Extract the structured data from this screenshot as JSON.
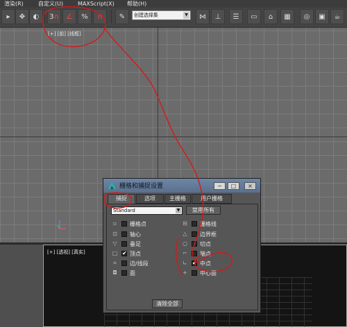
{
  "menu": [
    "渲染(R)",
    "自定义(U)",
    "MAXScript(X)",
    "帮助(H)"
  ],
  "toolbar": {
    "buttons": [
      "select-icon",
      "move-icon",
      "rotate-icon",
      "snap-3d-icon",
      "angle-snap-icon",
      "percent-snap-icon",
      "spinner-snap-icon",
      "named-selection-icon",
      "mirror-icon",
      "align-icon",
      "layer-icon",
      "graph-editor-icon",
      "schematic-icon",
      "material-editor-icon",
      "render-setup-icon",
      "render-frame-icon",
      "render-icon"
    ],
    "snap_label": "3",
    "percent_label": "%",
    "selection_set_placeholder": "创建选择集"
  },
  "viewports": {
    "top_label": "[+] [前] [线框]",
    "persp_label": "[+] [透视] [真实]"
  },
  "dialog": {
    "title": "栅格和捕捉设置",
    "tabs": [
      "捕捉",
      "选项",
      "主栅格",
      "用户栅格"
    ],
    "active_tab": "捕捉",
    "dropdown_value": "Standard",
    "disable_button": "禁用所有",
    "clear_button": "清除全部",
    "window_buttons": [
      "−",
      "□",
      "×"
    ],
    "left_options": [
      {
        "label": "栅格点",
        "checked": false,
        "icon": "grid-point-icon"
      },
      {
        "label": "轴心",
        "checked": false,
        "icon": "pivot-icon"
      },
      {
        "label": "垂足",
        "checked": false,
        "icon": "perpendicular-icon"
      },
      {
        "label": "顶点",
        "checked": true,
        "icon": "vertex-icon"
      },
      {
        "label": "边/线段",
        "checked": false,
        "icon": "edge-icon"
      },
      {
        "label": "面",
        "checked": false,
        "icon": "face-icon"
      }
    ],
    "right_options": [
      {
        "label": "栅格线",
        "checked": false,
        "icon": "grid-line-icon"
      },
      {
        "label": "边界框",
        "checked": false,
        "icon": "bounding-box-icon"
      },
      {
        "label": "切点",
        "checked": false,
        "icon": "tangent-icon"
      },
      {
        "label": "端点",
        "checked": false,
        "icon": "endpoint-icon"
      },
      {
        "label": "中点",
        "checked": true,
        "icon": "midpoint-icon"
      },
      {
        "label": "中心面",
        "checked": false,
        "icon": "center-face-icon"
      }
    ]
  },
  "colors": {
    "annotation": "#d41a1a",
    "title_bar": "#6e86a6"
  }
}
